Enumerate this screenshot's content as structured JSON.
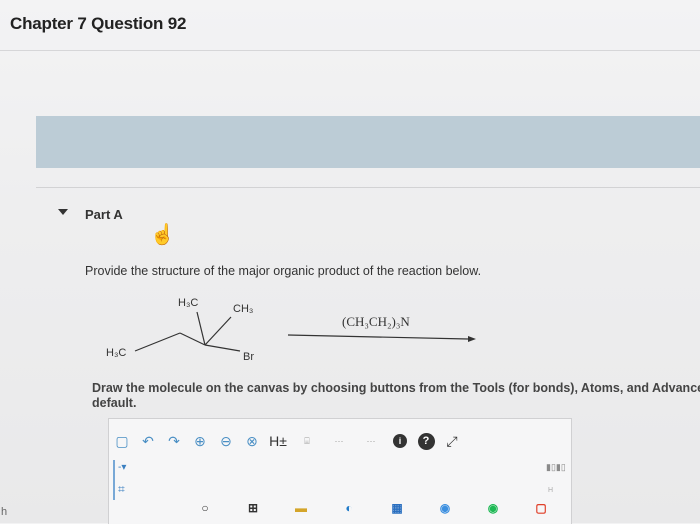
{
  "header": {
    "title": "Chapter 7 Question 92"
  },
  "part": {
    "label": "Part A",
    "prompt": "Provide the structure of the major organic product of the reaction below."
  },
  "reaction": {
    "h3c_top": "H₃C",
    "ch3_top": "CH₃",
    "h3c_left": "H₃C",
    "br": "Br",
    "reagent": "(CH₃CH₂)₃N"
  },
  "instructions": {
    "text": "Draw the molecule on the canvas by choosing buttons from the Tools (for bonds), Atoms, and Advanced T",
    "text2": "default."
  },
  "toolbar": {
    "h_label": "H±",
    "icons": [
      "new-document-icon",
      "undo-icon",
      "redo-icon",
      "zoom-in-icon",
      "zoom-out-icon",
      "clear-icon",
      "hydrogen-toggle-icon",
      "template-icon",
      "exp-icon",
      "cont-icon",
      "info-icon",
      "help-icon",
      "expand-icon"
    ]
  },
  "editor": {
    "side_tool_1": "‑▾",
    "side_tool_2": "⌗"
  },
  "left_edge": {
    "text": "h"
  },
  "mini_h": "H"
}
